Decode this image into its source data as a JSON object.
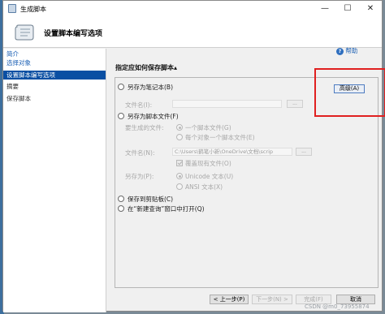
{
  "window": {
    "title": "生成脚本"
  },
  "titlebar_buttons": {
    "minimize": "—",
    "maximize": "☐",
    "close": "✕"
  },
  "header": {
    "title": "设置脚本编写选项"
  },
  "sidebar": {
    "items": [
      {
        "label": "简介",
        "state": "link"
      },
      {
        "label": "选择对象",
        "state": "link"
      },
      {
        "label": "设置脚本编写选项",
        "state": "active"
      },
      {
        "label": "摘要",
        "state": "plain"
      },
      {
        "label": "保存脚本",
        "state": "plain"
      }
    ]
  },
  "help": {
    "label": "帮助",
    "icon": "?"
  },
  "main": {
    "section_title": "指定应如何保存脚本",
    "advanced_button": "高级(A)",
    "options": {
      "notebook": {
        "label": "另存为笔记本(B)",
        "file_name_label": "文件名(I):",
        "browse": "..."
      },
      "script_file": {
        "label": "另存为脚本文件(F)",
        "files_to_generate_label": "要生成的文件:",
        "single_file": "一个脚本文件(G)",
        "per_object": "每个对象一个脚本文件(E)",
        "file_name_label": "文件名(N):",
        "file_name_value": "C:\\Users\\鹤笔小新\\OneDrive\\文档\\scrip",
        "browse": "...",
        "overwrite": "覆盖现有文件(O)",
        "save_as_label": "另存为(P):",
        "unicode": "Unicode 文本(U)",
        "ansi": "ANSI 文本(X)"
      },
      "clipboard": {
        "label": "保存到剪贴板(C)"
      },
      "new_query": {
        "label": "在“新建查询”窗口中打开(Q)"
      }
    }
  },
  "footer": {
    "prev": "< 上一步(P)",
    "next": "下一步(N) >",
    "finish": "完成(F)",
    "cancel": "取消"
  },
  "watermark": "CSDN @m0_73955874",
  "colors": {
    "accent": "#0a4fa3",
    "highlight_box": "#e02020",
    "link": "#1a5fb4"
  }
}
